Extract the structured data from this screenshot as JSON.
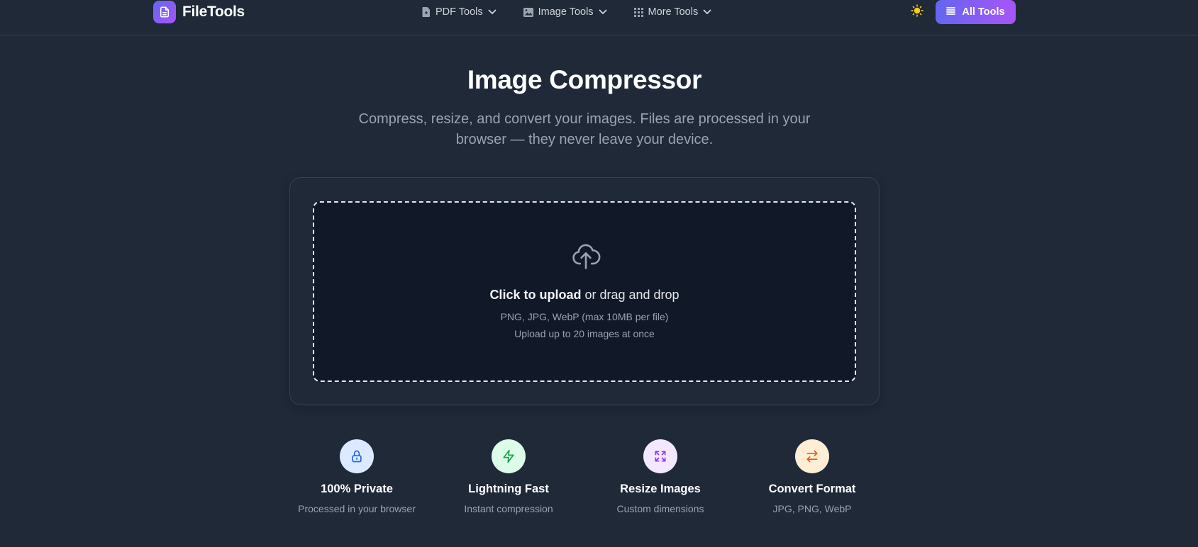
{
  "brand": {
    "name": "FileTools",
    "logo_icon": "document-icon",
    "accent_gradient": [
      "#6366f1",
      "#a855f7"
    ]
  },
  "nav": {
    "items": [
      {
        "label": "PDF Tools",
        "icon": "file-icon"
      },
      {
        "label": "Image Tools",
        "icon": "image-icon"
      },
      {
        "label": "More Tools",
        "icon": "grid-icon"
      }
    ],
    "theme_toggle_icon": "sun-icon",
    "all_tools_label": "All Tools",
    "all_tools_icon": "menu-icon"
  },
  "hero": {
    "title": "Image Compressor",
    "subtitle": "Compress, resize, and convert your images. Files are processed in your browser — they never leave your device."
  },
  "upload": {
    "icon": "cloud-upload-icon",
    "click_text": "Click to upload",
    "drag_text": "or drag and drop",
    "formats_hint": "PNG, JPG, WebP (max 10MB per file)",
    "limit_hint": "Upload up to 20 images at once"
  },
  "features": [
    {
      "title": "100% Private",
      "desc": "Processed in your browser",
      "icon": "lock-icon",
      "bg": "#dbeafe",
      "color": "#2563eb"
    },
    {
      "title": "Lightning Fast",
      "desc": "Instant compression",
      "icon": "bolt-icon",
      "bg": "#dcfce7",
      "color": "#16a34a"
    },
    {
      "title": "Resize Images",
      "desc": "Custom dimensions",
      "icon": "expand-icon",
      "bg": "#f3e8ff",
      "color": "#9333ea"
    },
    {
      "title": "Convert Format",
      "desc": "JPG, PNG, WebP",
      "icon": "swap-arrows-icon",
      "bg": "#ffedd5",
      "color": "#ea580c"
    }
  ]
}
